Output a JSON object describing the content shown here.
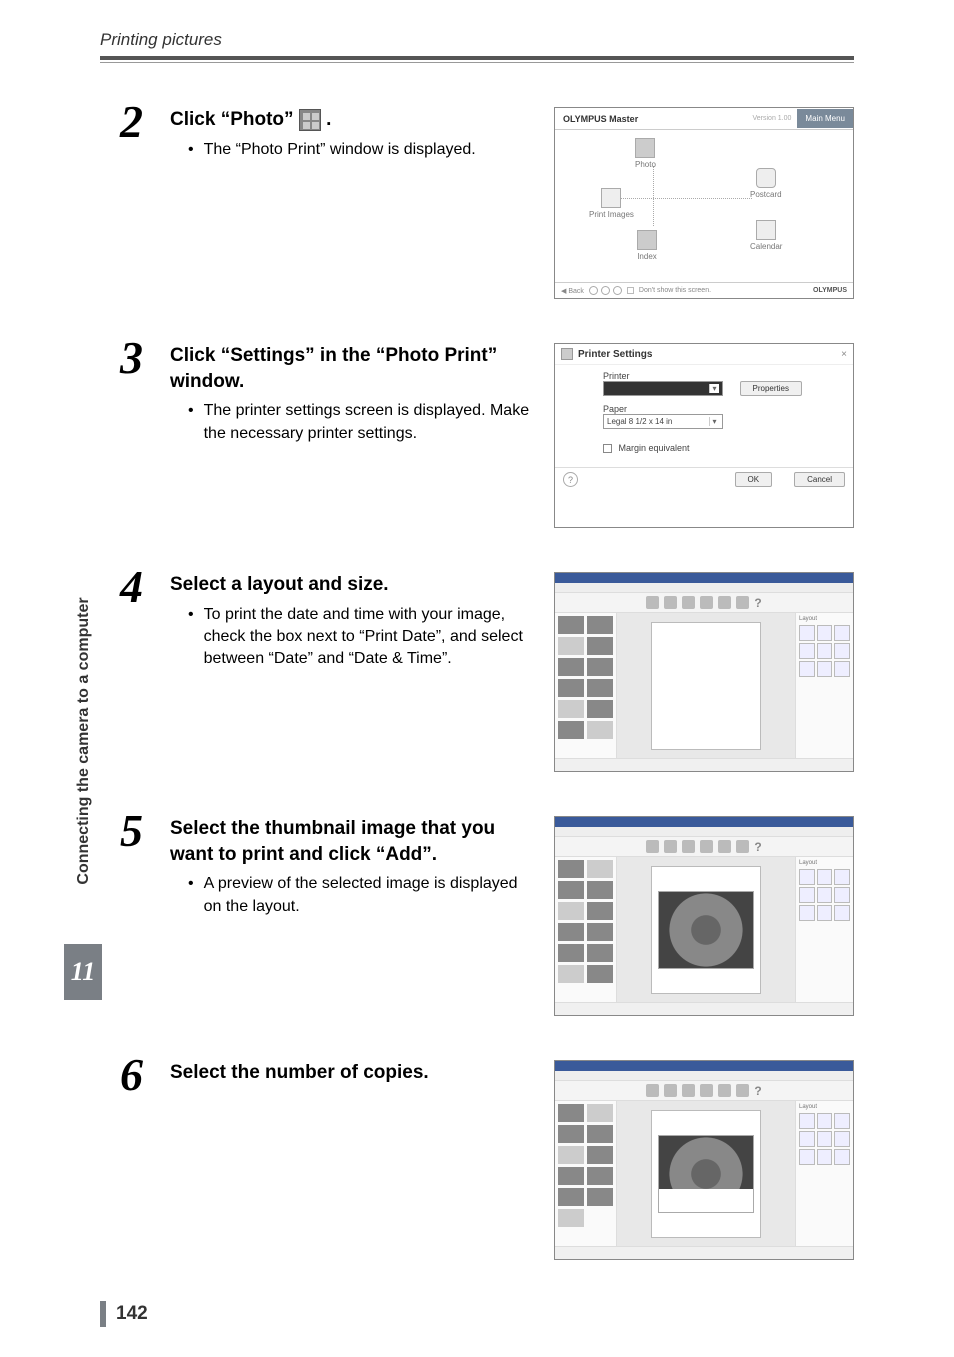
{
  "header": {
    "section_title": "Printing pictures"
  },
  "side_tab": {
    "label": "Connecting the camera to a computer",
    "chapter": "11"
  },
  "page_number": "142",
  "steps": [
    {
      "num": "2",
      "title_pre": "Click “Photo” ",
      "title_post": ".",
      "has_icon": true,
      "bullets": [
        "The “Photo Print” window is displayed."
      ]
    },
    {
      "num": "3",
      "title_pre": "Click “Settings” in the “Photo Print” window.",
      "title_post": "",
      "has_icon": false,
      "bullets": [
        "The printer settings screen is displayed. Make the necessary printer settings."
      ]
    },
    {
      "num": "4",
      "title_pre": "Select a layout and size.",
      "title_post": "",
      "has_icon": false,
      "bullets": [
        "To print the date and time with your image, check the box next to “Print Date”, and select between “Date” and “Date & Time”."
      ]
    },
    {
      "num": "5",
      "title_pre": "Select the thumbnail image that you want to print and click “Add”.",
      "title_post": "",
      "has_icon": false,
      "bullets": [
        "A preview of the selected image is displayed on the layout."
      ]
    },
    {
      "num": "6",
      "title_pre": "Select the number of copies.",
      "title_post": "",
      "has_icon": false,
      "bullets": []
    }
  ],
  "fig1": {
    "app_title": "OLYMPUS Master",
    "version": "Version 1.00",
    "main_menu": "Main Menu",
    "items": {
      "photo": "Photo",
      "print_images": "Print Images",
      "index": "Index",
      "postcard": "Postcard",
      "calendar": "Calendar"
    },
    "back": "◀ Back",
    "dont_show": "Don't show this screen.",
    "brand": "OLYMPUS"
  },
  "fig2": {
    "title": "Printer Settings",
    "printer_label": "Printer",
    "paper_label": "Paper",
    "paper_value": "Legal 8 1/2 x 14 in",
    "margin_label": "Margin equivalent",
    "properties": "Properties",
    "ok": "OK",
    "cancel": "Cancel"
  },
  "figedit": {
    "side_label_layout": "Layout"
  }
}
